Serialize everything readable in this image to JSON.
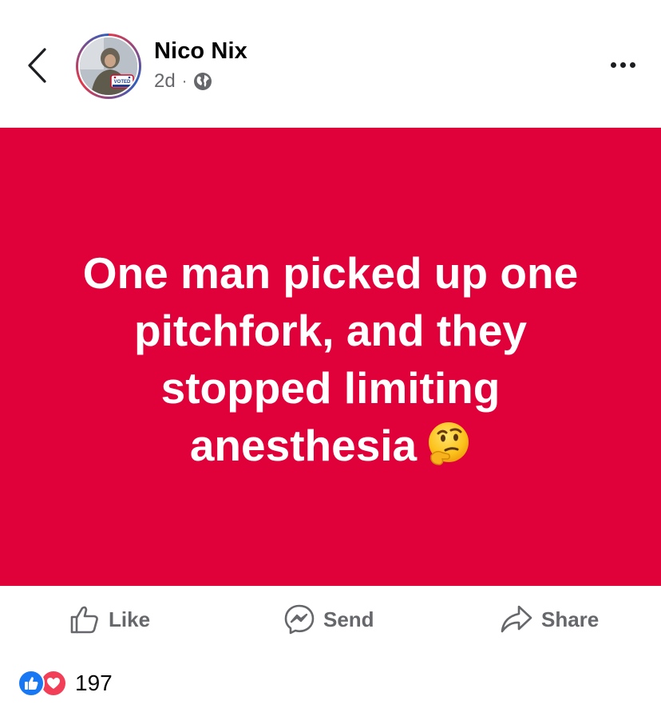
{
  "header": {
    "author_name": "Nico Nix",
    "timestamp": "2d",
    "separator": "·",
    "privacy_icon": "globe-icon",
    "back_icon": "chevron-left-icon",
    "more_icon": "more-dots-icon",
    "avatar_badge_text": "VOTED"
  },
  "post": {
    "text": "One man picked up one pitchfork, and they stopped limiting anesthesia",
    "emoji": "thinking-face-emoji",
    "background_color": "#e0003a",
    "text_color": "#ffffff"
  },
  "actions": {
    "like_label": "Like",
    "send_label": "Send",
    "share_label": "Share"
  },
  "reactions": {
    "icons": [
      "like-reaction-icon",
      "love-reaction-icon"
    ],
    "count": "197"
  },
  "colors": {
    "secondary_text": "#65676b",
    "like_blue": "#1877f2",
    "love_red": "#f33e58"
  }
}
